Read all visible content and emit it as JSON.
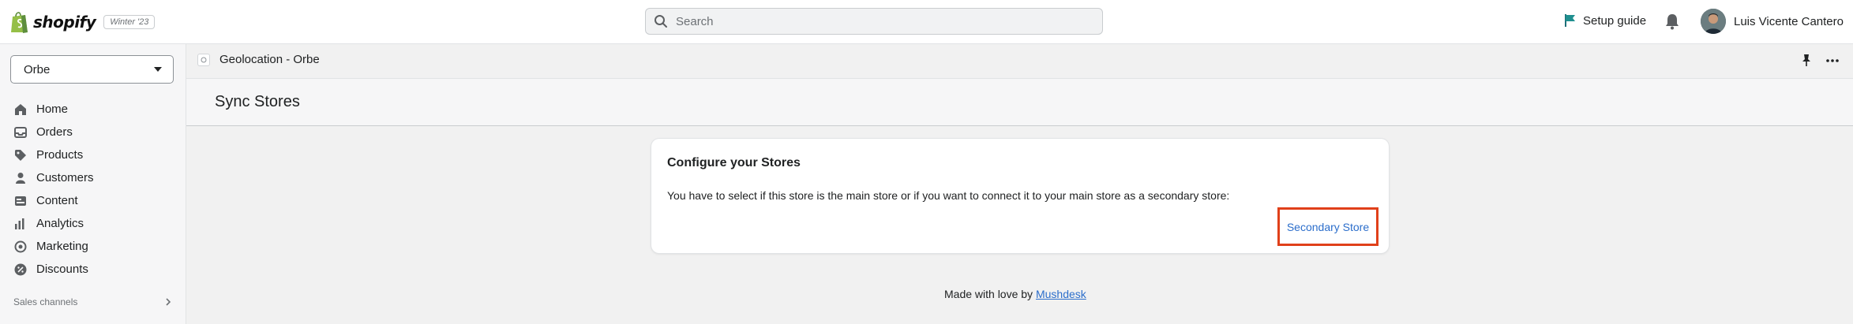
{
  "topbar": {
    "logo_text": "shopify",
    "edition": "Winter '23",
    "search_placeholder": "Search",
    "setup_guide": "Setup guide",
    "user_name": "Luis Vicente Cantero"
  },
  "sidebar": {
    "store": "Orbe",
    "items": [
      {
        "label": "Home",
        "icon": "home-icon"
      },
      {
        "label": "Orders",
        "icon": "orders-icon"
      },
      {
        "label": "Products",
        "icon": "tag-icon"
      },
      {
        "label": "Customers",
        "icon": "person-icon"
      },
      {
        "label": "Content",
        "icon": "content-icon"
      },
      {
        "label": "Analytics",
        "icon": "bar-chart-icon"
      },
      {
        "label": "Marketing",
        "icon": "target-icon"
      },
      {
        "label": "Discounts",
        "icon": "discount-icon"
      }
    ],
    "sales_channels": "Sales channels"
  },
  "app": {
    "title": "Geolocation - Orbe"
  },
  "page": {
    "title": "Sync Stores"
  },
  "card": {
    "title": "Configure your Stores",
    "text": "You have to select if this store is the main store or if you want to connect it to your main store as a secondary store:",
    "button": "Secondary Store"
  },
  "footer": {
    "text": "Made with love by",
    "link": "Mushdesk"
  },
  "colors": {
    "accent": "#2c6ecb",
    "highlight": "#e0401a",
    "shopify_green": "#95bf47"
  }
}
